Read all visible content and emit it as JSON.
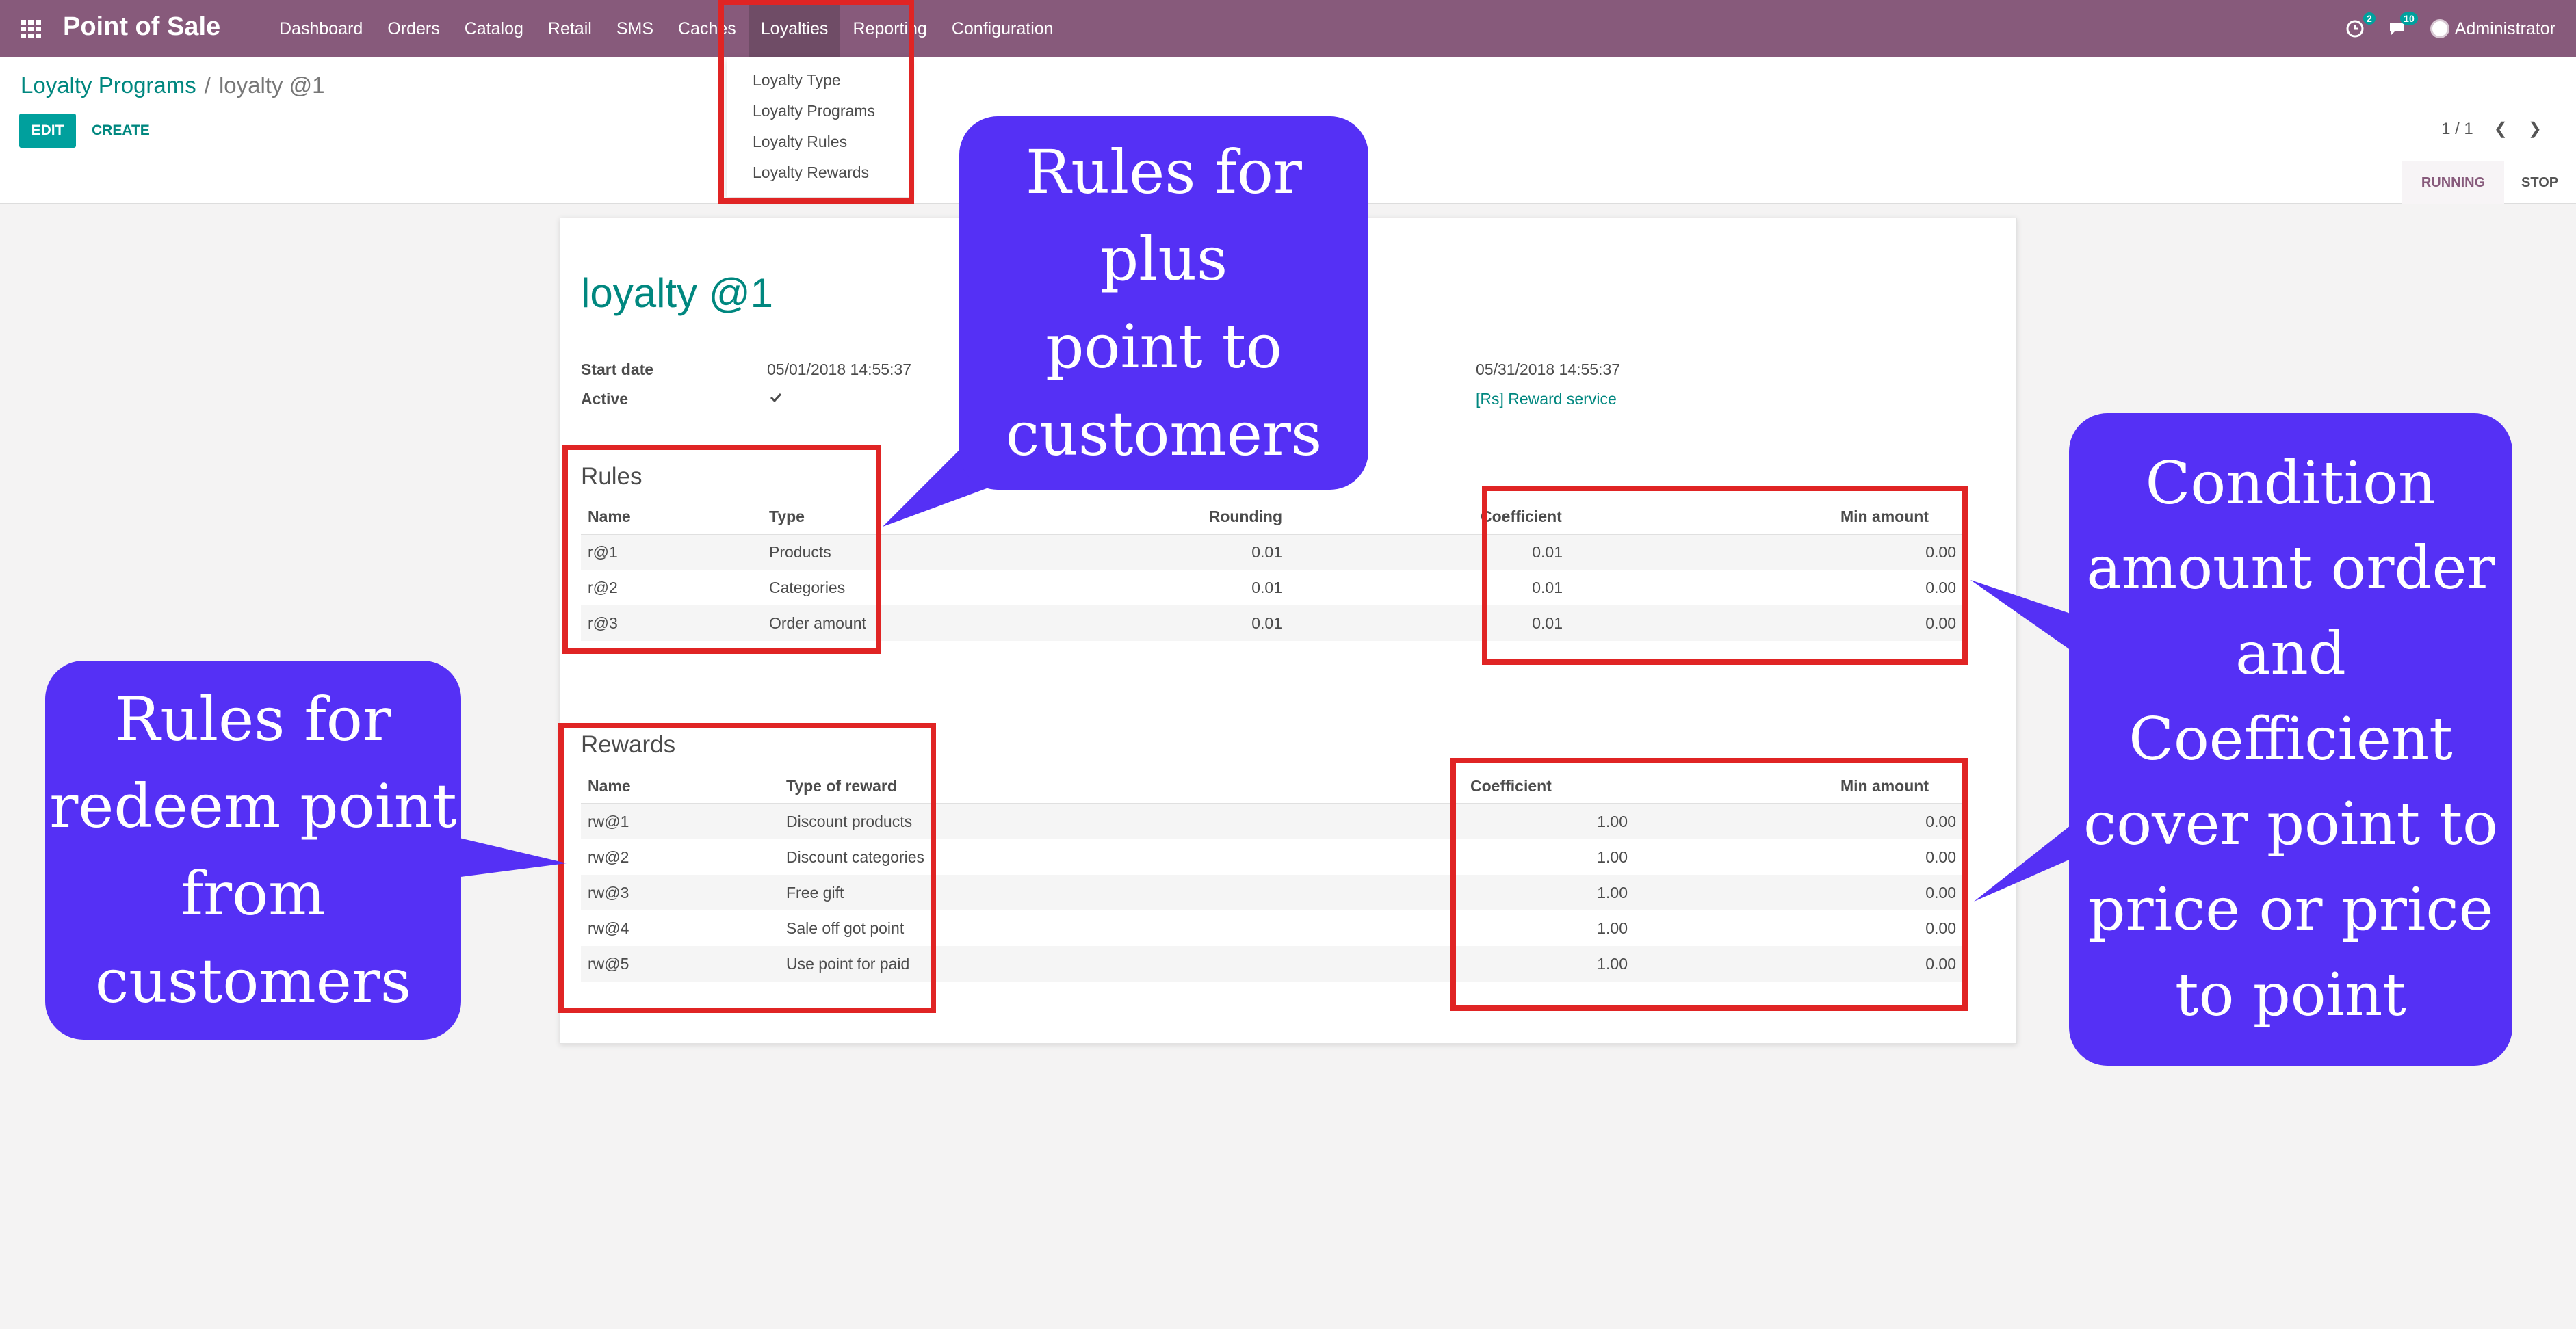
{
  "navbar": {
    "app_title": "Point of Sale",
    "menu": [
      "Dashboard",
      "Orders",
      "Catalog",
      "Retail",
      "SMS",
      "Caches",
      "Loyalties",
      "Reporting",
      "Configuration"
    ],
    "activity_badge": "2",
    "messages_badge": "10",
    "user": "Administrator"
  },
  "dropdown": {
    "items": [
      "Loyalty Type",
      "Loyalty Programs",
      "Loyalty Rules",
      "Loyalty Rewards"
    ]
  },
  "breadcrumb": {
    "parent": "Loyalty Programs",
    "separator": "/",
    "current": "loyalty @1"
  },
  "buttons": {
    "edit": "EDIT",
    "create": "CREATE"
  },
  "pager": {
    "value": "1 / 1"
  },
  "status": {
    "running": "RUNNING",
    "stop": "STOP"
  },
  "form": {
    "title": "loyalty @1",
    "start_date_label": "Start date",
    "start_date": "05/01/2018 14:55:37",
    "active_label": "Active",
    "end_date": "05/31/2018 14:55:37",
    "product_service": "[Rs] Reward service"
  },
  "rules": {
    "title": "Rules",
    "headers": [
      "Name",
      "Type",
      "Rounding",
      "Coefficient",
      "Min amount"
    ],
    "rows": [
      [
        "r@1",
        "Products",
        "0.01",
        "0.01",
        "0.00"
      ],
      [
        "r@2",
        "Categories",
        "0.01",
        "0.01",
        "0.00"
      ],
      [
        "r@3",
        "Order amount",
        "0.01",
        "0.01",
        "0.00"
      ]
    ]
  },
  "rewards": {
    "title": "Rewards",
    "headers": [
      "Name",
      "Type of reward",
      "Coefficient",
      "Min amount"
    ],
    "rows": [
      [
        "rw@1",
        "Discount products",
        "1.00",
        "0.00"
      ],
      [
        "rw@2",
        "Discount categories",
        "1.00",
        "0.00"
      ],
      [
        "rw@3",
        "Free gift",
        "1.00",
        "0.00"
      ],
      [
        "rw@4",
        "Sale off got point",
        "1.00",
        "0.00"
      ],
      [
        "rw@5",
        "Use point for paid",
        "1.00",
        "0.00"
      ]
    ]
  },
  "annotations": {
    "top_callout": [
      "Rules for plus",
      "point to",
      "customers"
    ],
    "left_callout": [
      "Rules for",
      "redeem point",
      "from",
      "customers"
    ],
    "right_callout": [
      "Condition",
      "amount order",
      "and Coefficient",
      "cover point to",
      "price or price",
      "to point"
    ]
  },
  "colors": {
    "navbar": "#875a7b",
    "accent": "#00a09d",
    "callout": "#5530f5",
    "highlight": "#e02424"
  }
}
